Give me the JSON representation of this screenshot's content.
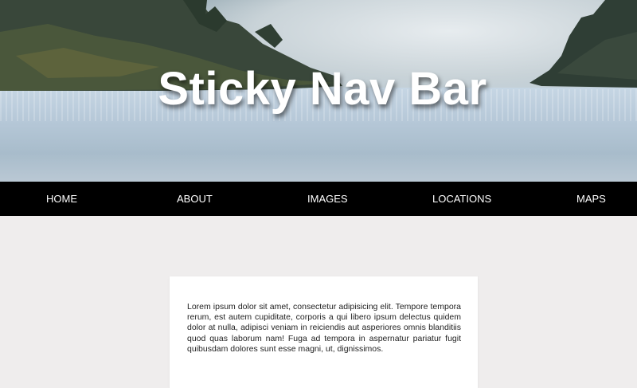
{
  "hero": {
    "title": "Sticky Nav Bar"
  },
  "nav": {
    "items": [
      {
        "label": "HOME"
      },
      {
        "label": "ABOUT"
      },
      {
        "label": "IMAGES"
      },
      {
        "label": "LOCATIONS"
      },
      {
        "label": "MAPS"
      }
    ]
  },
  "content": {
    "paragraph": "Lorem ipsum dolor sit amet, consectetur adipisicing elit. Tempore tempora rerum, est autem cupiditate, corporis a qui libero ipsum delectus quidem dolor at nulla, adipisci veniam in reiciendis aut asperiores omnis blanditiis quod quas laborum nam! Fuga ad tempora in aspernatur pariatur fugit quibusdam dolores sunt esse magni, ut, dignissimos."
  },
  "colors": {
    "page_background": "#efeded",
    "nav_background": "#000000",
    "nav_text": "#ffffff",
    "card_background": "#ffffff"
  }
}
